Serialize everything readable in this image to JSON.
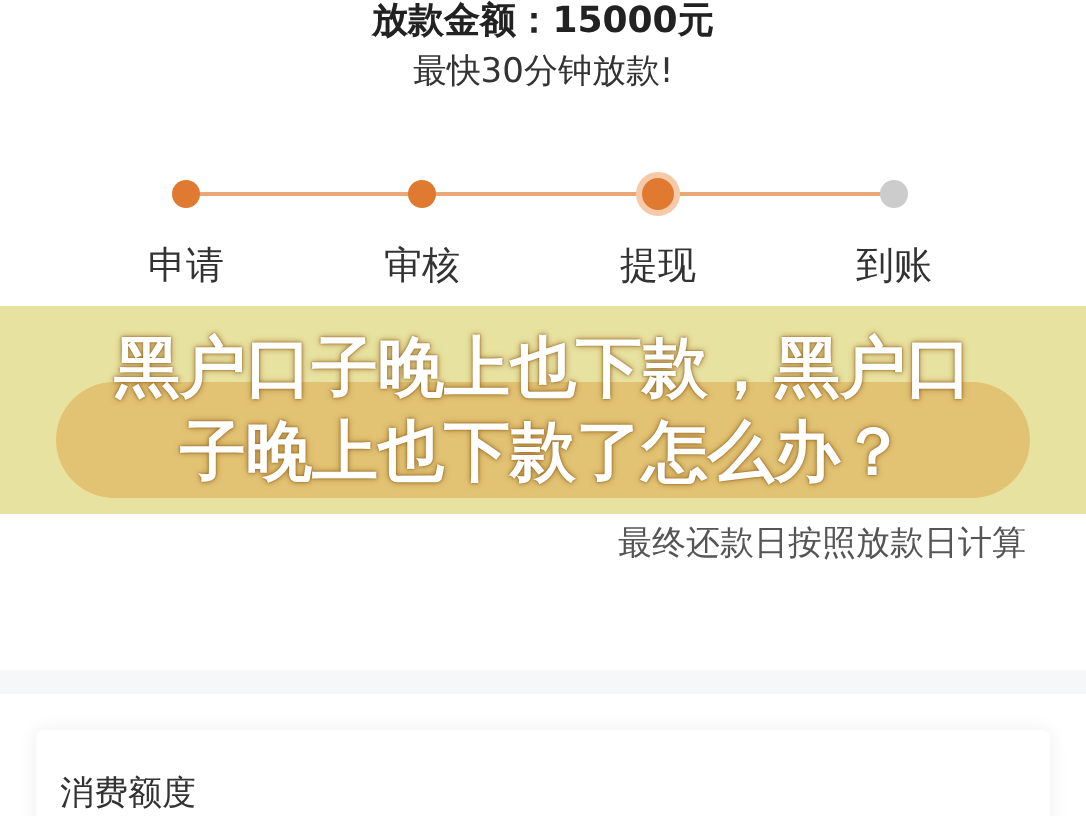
{
  "amount_heading": "放款金额：15000元",
  "subtitle": "最快30分钟放款!",
  "steps": [
    {
      "label": "申请",
      "completed": true,
      "selected": false
    },
    {
      "label": "审核",
      "completed": true,
      "selected": false
    },
    {
      "label": "提现",
      "completed": false,
      "selected": true
    },
    {
      "label": "到账",
      "completed": false,
      "selected": false
    }
  ],
  "overlay_title": "黑户口子晚上也下款，黑户口子晚上也下款了怎么办？",
  "repayment_note": "最终还款日按照放款日计算",
  "card": {
    "title": "消费额度"
  }
}
